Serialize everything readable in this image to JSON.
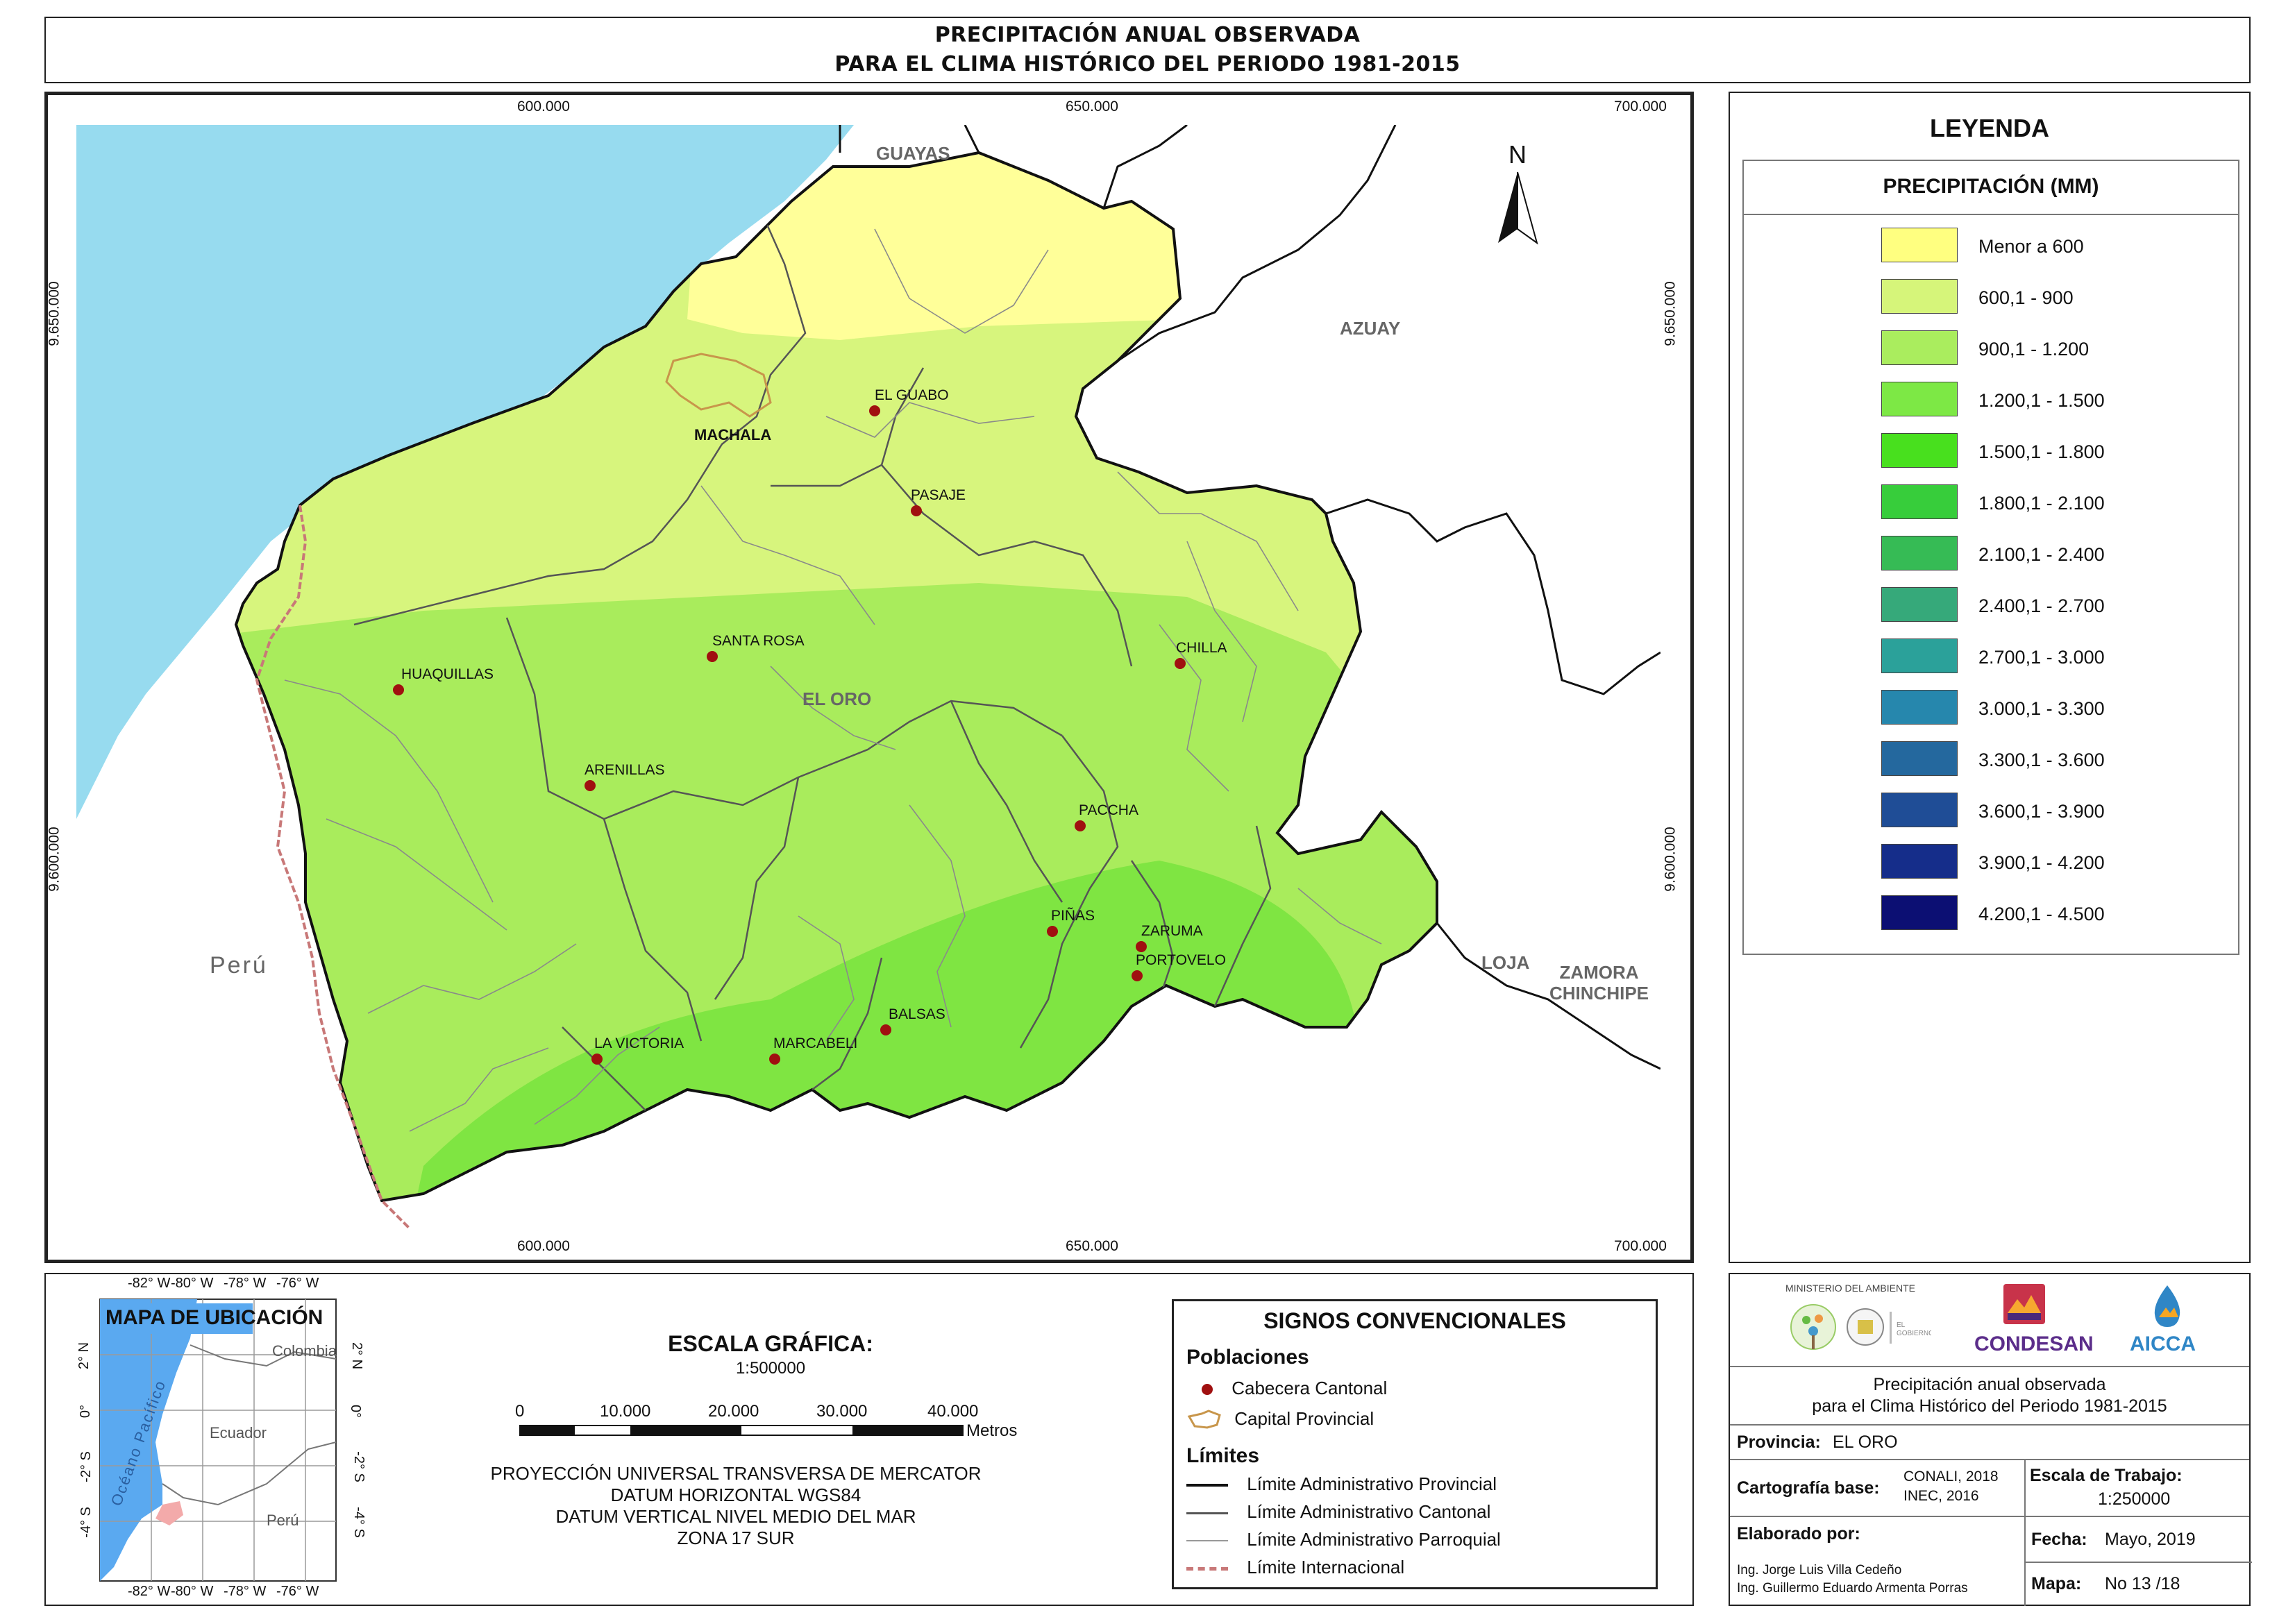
{
  "title": {
    "line1": "PRECIPITACIÓN ANUAL OBSERVADA",
    "line2": "PARA EL CLIMA HISTÓRICO DEL PERIODO 1981-2015"
  },
  "map": {
    "x_ticks": [
      "600.000",
      "650.000",
      "700.000"
    ],
    "y_ticks": [
      "9.650.000",
      "9.600.000"
    ],
    "north_label": "N",
    "regions": {
      "guayas": "GUAYAS",
      "azuay": "AZUAY",
      "el_oro": "EL ORO",
      "peru": "Perú",
      "loja": "LOJA",
      "zamora_1": "ZAMORA",
      "zamora_2": "CHINCHIPE",
      "machala": "MACHALA"
    },
    "towns": [
      {
        "name": "EL GUABO"
      },
      {
        "name": "PASAJE"
      },
      {
        "name": "SANTA ROSA"
      },
      {
        "name": "CHILLA"
      },
      {
        "name": "HUAQUILLAS"
      },
      {
        "name": "ARENILLAS"
      },
      {
        "name": "PACCHA"
      },
      {
        "name": "PIÑAS"
      },
      {
        "name": "ZARUMA"
      },
      {
        "name": "PORTOVELO"
      },
      {
        "name": "BALSAS"
      },
      {
        "name": "LA VICTORIA"
      },
      {
        "name": "MARCABELI"
      }
    ],
    "colors": {
      "ocean": "#97dbef",
      "outside": "#ffffff",
      "band_1": "#ffff99",
      "band_2": "#d7f57d",
      "band_3": "#a9ec5c",
      "band_4": "#7fe542",
      "town_dot": "#a01010",
      "capital": "#c8964b",
      "international": "#c87878"
    }
  },
  "legend": {
    "heading": "LEYENDA",
    "subheading": "PRECIPITACIÓN (MM)",
    "items": [
      {
        "label": "Menor a 600",
        "color": "#ffff80"
      },
      {
        "label": "600,1 - 900",
        "color": "#d6f57a"
      },
      {
        "label": "900,1 - 1.200",
        "color": "#aaed5e"
      },
      {
        "label": "1.200,1 - 1.500",
        "color": "#7de845"
      },
      {
        "label": "1.500,1 - 1.800",
        "color": "#48e01e"
      },
      {
        "label": "1.800,1 - 2.100",
        "color": "#37cd3b"
      },
      {
        "label": "2.100,1 - 2.400",
        "color": "#36bb55"
      },
      {
        "label": "2.400,1 - 2.700",
        "color": "#36a97a"
      },
      {
        "label": "2.700,1 - 3.000",
        "color": "#2ba19a"
      },
      {
        "label": "3.000,1 - 3.300",
        "color": "#2687ad"
      },
      {
        "label": "3.300,1 - 3.600",
        "color": "#24689e"
      },
      {
        "label": "3.600,1 - 3.900",
        "color": "#1f4d96"
      },
      {
        "label": "3.900,1 - 4.200",
        "color": "#152d8a"
      },
      {
        "label": "4.200,1 - 4.500",
        "color": "#0c0f73"
      }
    ]
  },
  "location_map": {
    "title": "MAPA DE UBICACIÓN",
    "lon_ticks": [
      "-82° W",
      "-80° W",
      "-78° W",
      "-76° W"
    ],
    "lat_ticks": [
      "2° N",
      "0°",
      "-2° S",
      "-4° S"
    ],
    "labels": {
      "colombia": "Colombia",
      "ecuador": "Ecuador",
      "peru": "Perú",
      "ocean": "Océano Pacífico"
    }
  },
  "scale": {
    "title": "ESCALA GRÁFICA:",
    "ratio": "1:500000",
    "ticks": [
      "0",
      "10.000",
      "20.000",
      "30.000",
      "40.000"
    ],
    "unit": "Metros",
    "projection": [
      "PROYECCIÓN UNIVERSAL TRANSVERSA DE MERCATOR",
      "DATUM HORIZONTAL WGS84",
      "DATUM VERTICAL NIVEL MEDIO DEL MAR",
      "ZONA 17 SUR"
    ]
  },
  "signs": {
    "title": "SIGNOS CONVENCIONALES",
    "populations_heading": "Poblaciones",
    "cabecera": "Cabecera Cantonal",
    "capital": "Capital Provincial",
    "limits_heading": "Límites",
    "provincial": "Límite Administrativo Provincial",
    "cantonal": "Límite Administrativo Cantonal",
    "parroquial": "Límite Administrativo Parroquial",
    "internacional": "Límite Internacional"
  },
  "info": {
    "logo_ministry": "MINISTERIO DEL AMBIENTE",
    "logo_condesan": "CONDESAN",
    "logo_aicca": "AICCA",
    "map_title_1": "Precipitación anual observada",
    "map_title_2": "para el Clima Histórico del Periodo 1981-2015",
    "province_label": "Provincia:",
    "province_value": "EL ORO",
    "cartography_label": "Cartografía base:",
    "cartography_value_1": "CONALI, 2018",
    "cartography_value_2": "INEC, 2016",
    "scale_label": "Escala de Trabajo:",
    "scale_value": "1:250000",
    "authors_label": "Elaborado por:",
    "author_1": "Ing. Jorge Luis Villa Cedeño",
    "author_2": "Ing. Guillermo Eduardo Armenta Porras",
    "date_label": "Fecha:",
    "date_value": "Mayo, 2019",
    "map_label": "Mapa:",
    "map_value": "No 13 /18"
  }
}
